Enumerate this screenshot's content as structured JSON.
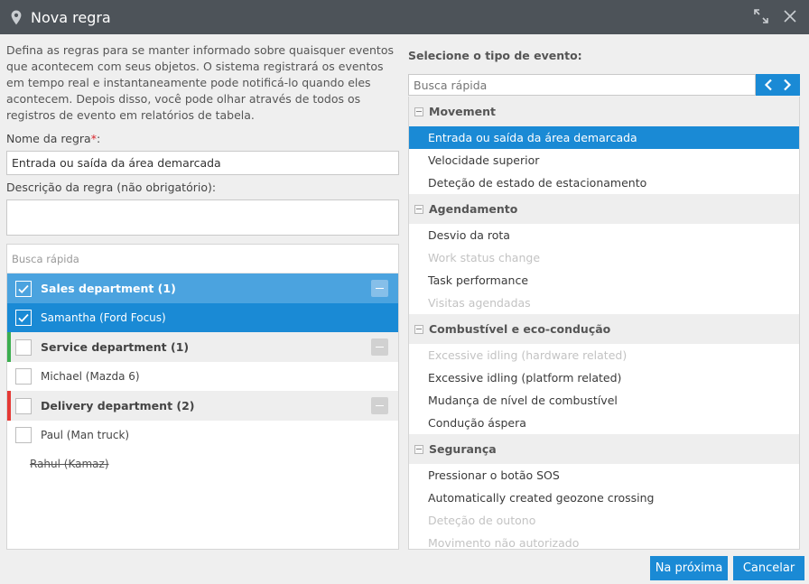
{
  "window": {
    "title": "Nova regra"
  },
  "description": "Defina as regras para se manter informado sobre quaisquer eventos que acontecem com seus objetos. O sistema registrará os eventos em tempo real e instantaneamente pode notificá-lo quando eles acontecem. Depois disso, você pode olhar através de todos os registros de evento em relatórios de tabela.",
  "rule_name": {
    "label": "Nome da regra",
    "required_mark": "*",
    "value": "Entrada ou saída da área demarcada"
  },
  "rule_description": {
    "label": "Descrição da regra (não obrigatório):",
    "value": ""
  },
  "objects": {
    "search_placeholder": "Busca rápida",
    "groups": [
      {
        "name": "Sales department (1)",
        "color": "#4ba3df",
        "items": [
          "Samantha (Ford Focus)"
        ]
      },
      {
        "name": "Service department (1)",
        "color": "#3cae4f",
        "items": [
          "Michael (Mazda 6)"
        ]
      },
      {
        "name": "Delivery department (2)",
        "color": "#e53935",
        "items": [
          "Paul (Man truck)",
          "Rahul (Kamaz)"
        ]
      }
    ]
  },
  "events": {
    "label": "Selecione o tipo de evento:",
    "search_placeholder": "Busca rápida",
    "categories": [
      {
        "name": "Movement",
        "items": [
          "Entrada ou saída da área demarcada",
          "Velocidade superior",
          "Deteção de estado de estacionamento"
        ]
      },
      {
        "name": "Agendamento",
        "items": [
          "Desvio da rota",
          "Work status change",
          "Task performance",
          "Visitas agendadas"
        ]
      },
      {
        "name": "Combustível e eco-condução",
        "items": [
          "Excessive idling (hardware related)",
          "Excessive idling (platform related)",
          "Mudança de nível de combustível",
          "Condução áspera"
        ]
      },
      {
        "name": "Segurança",
        "items": [
          "Pressionar o botão SOS",
          "Automatically created geozone crossing",
          "Deteção de outono",
          "Movimento não autorizado"
        ]
      }
    ]
  },
  "buttons": {
    "next": "Na próxima",
    "cancel": "Cancelar"
  },
  "colors": {
    "accent": "#1a8ad5",
    "titlebar": "#4d5359",
    "selected_group": "#4ba3df"
  }
}
